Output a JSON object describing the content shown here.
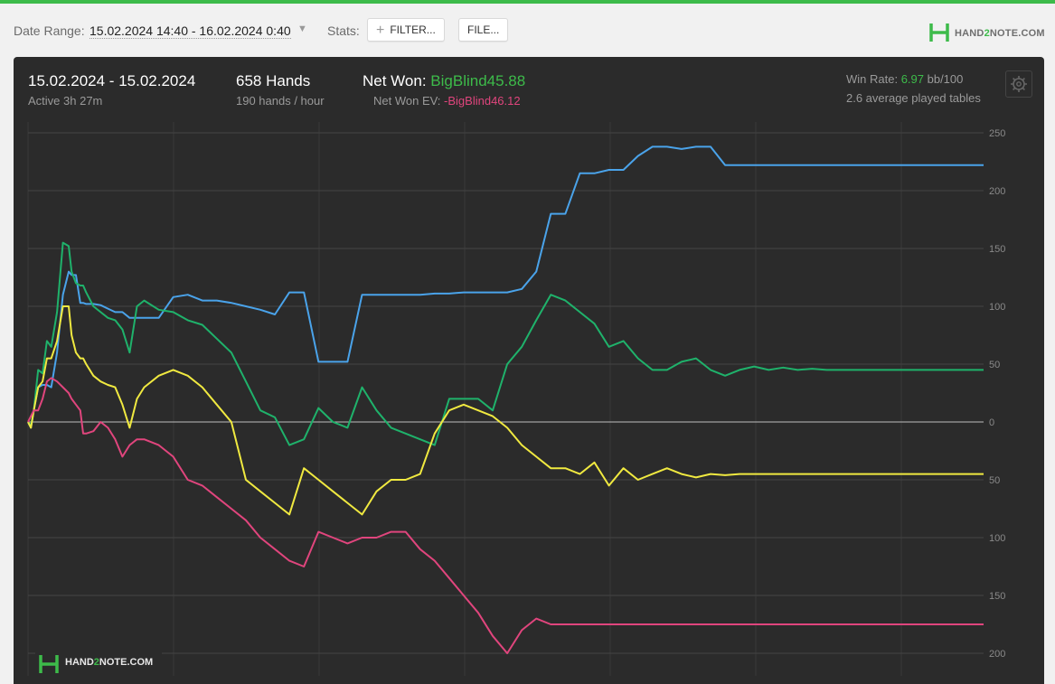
{
  "toolbar": {
    "date_range_label": "Date Range:",
    "date_range_value": "15.02.2024 14:40 - 16.02.2024 0:40",
    "stats_label": "Stats:",
    "filter_label": "FILTER...",
    "file_label": "FILE..."
  },
  "brand": {
    "left": "HAND",
    "mid": "2",
    "right": "NOTE.COM"
  },
  "summary": {
    "date_span": "15.02.2024 - 15.02.2024",
    "active": "Active 3h 27m",
    "hands": "658 Hands",
    "hands_rate": "190 hands / hour",
    "net_won_label": "Net Won: ",
    "net_won_value": "BigBlind45.88",
    "net_won_ev_label": "Net Won  EV: ",
    "net_won_ev_value": "-BigBlind46.12",
    "win_rate_label": "Win Rate: ",
    "win_rate_value": "6.97",
    "win_rate_unit": " bb/100",
    "tables": "2.6 average played tables"
  },
  "colors": {
    "accent": "#3dbb4a",
    "panel": "#2b2b2b",
    "blue": "#4aa3ea",
    "green": "#1fb26b",
    "yellow": "#f0e940",
    "pink": "#e0457d"
  },
  "icons": {
    "settings": "gear-icon",
    "filter": "plus-icon",
    "dropdown": "chevron-down-icon",
    "logo": "hand2note-logo-icon"
  },
  "chart_data": {
    "type": "line",
    "ylim": [
      -205,
      255
    ],
    "y_ticks": [
      250,
      200,
      150,
      100,
      50,
      0,
      -50,
      -100,
      -150,
      -200
    ],
    "y_tick_labels": [
      "250",
      "200",
      "150",
      "100",
      "50",
      "0",
      "50",
      "100",
      "150",
      "200"
    ],
    "x": [
      0,
      2,
      4,
      7,
      10,
      13,
      16,
      20,
      24,
      28,
      30,
      33,
      36,
      38,
      40,
      45,
      50,
      55,
      60,
      65,
      70,
      75,
      80,
      90,
      100,
      110,
      120,
      130,
      140,
      150,
      160,
      170,
      180,
      190,
      200,
      210,
      220,
      230,
      240,
      250,
      260,
      270,
      280,
      290,
      300,
      310,
      320,
      330,
      340,
      350,
      360,
      370,
      380,
      390,
      400,
      410,
      420,
      430,
      440,
      450,
      460,
      470,
      480,
      490,
      500,
      510,
      520,
      530,
      540,
      550,
      560,
      570,
      580,
      590,
      600,
      610,
      620,
      630,
      640,
      650,
      658
    ],
    "series": [
      {
        "color": "#4aa3ea",
        "values": [
          0,
          -5,
          10,
          30,
          32,
          32,
          30,
          60,
          110,
          130,
          127,
          127,
          103,
          103,
          102,
          102,
          101,
          98,
          95,
          95,
          90,
          90,
          90,
          90,
          108,
          110,
          105,
          105,
          103,
          100,
          97,
          93,
          112,
          112,
          52,
          52,
          52,
          110,
          110,
          110,
          110,
          110,
          111,
          111,
          112,
          112,
          112,
          112,
          115,
          130,
          180,
          180,
          215,
          215,
          218,
          218,
          230,
          238,
          238,
          236,
          238,
          238,
          222,
          222,
          222,
          222,
          222,
          222,
          222,
          222,
          222,
          222,
          222,
          222,
          222,
          222,
          222,
          222,
          222,
          222,
          222
        ]
      },
      {
        "color": "#1fb26b",
        "values": [
          0,
          -3,
          10,
          45,
          42,
          70,
          65,
          95,
          155,
          152,
          130,
          120,
          118,
          118,
          112,
          100,
          95,
          90,
          88,
          80,
          60,
          100,
          105,
          97,
          95,
          88,
          84,
          72,
          60,
          35,
          10,
          4,
          -20,
          -15,
          12,
          0,
          -5,
          30,
          10,
          -5,
          -10,
          -15,
          -20,
          20,
          20,
          20,
          10,
          50,
          65,
          88,
          110,
          105,
          95,
          85,
          65,
          70,
          55,
          45,
          45,
          52,
          55,
          45,
          40,
          45,
          48,
          45,
          47,
          45,
          46,
          45,
          45,
          45,
          45,
          45,
          45,
          45,
          45,
          45,
          45,
          45,
          45
        ]
      },
      {
        "color": "#f0e940",
        "values": [
          0,
          -5,
          10,
          30,
          35,
          55,
          55,
          70,
          100,
          100,
          75,
          60,
          55,
          55,
          50,
          40,
          35,
          32,
          30,
          15,
          -5,
          20,
          30,
          40,
          45,
          40,
          30,
          15,
          0,
          -50,
          -60,
          -70,
          -80,
          -40,
          -50,
          -60,
          -70,
          -80,
          -60,
          -50,
          -50,
          -45,
          -10,
          10,
          15,
          10,
          5,
          -5,
          -20,
          -30,
          -40,
          -40,
          -45,
          -35,
          -55,
          -40,
          -50,
          -45,
          -40,
          -45,
          -48,
          -45,
          -46,
          -45,
          -45,
          -45,
          -45,
          -45,
          -45,
          -45,
          -45,
          -45,
          -45,
          -45,
          -45,
          -45,
          -45,
          -45,
          -45,
          -45,
          -45
        ]
      },
      {
        "color": "#e0457d",
        "values": [
          0,
          5,
          10,
          10,
          20,
          35,
          38,
          35,
          30,
          25,
          20,
          15,
          10,
          -10,
          -10,
          -8,
          0,
          -5,
          -15,
          -30,
          -20,
          -15,
          -15,
          -20,
          -30,
          -50,
          -55,
          -65,
          -75,
          -85,
          -100,
          -110,
          -120,
          -125,
          -95,
          -100,
          -105,
          -100,
          -100,
          -95,
          -95,
          -110,
          -120,
          -135,
          -150,
          -165,
          -185,
          -200,
          -180,
          -170,
          -175,
          -175,
          -175,
          -175,
          -175,
          -175,
          -175,
          -175,
          -175,
          -175,
          -175,
          -175,
          -175,
          -175,
          -175,
          -175,
          -175,
          -175,
          -175,
          -175,
          -175,
          -175,
          -175,
          -175,
          -175,
          -175,
          -175,
          -175,
          -175,
          -175,
          -175
        ]
      }
    ]
  }
}
